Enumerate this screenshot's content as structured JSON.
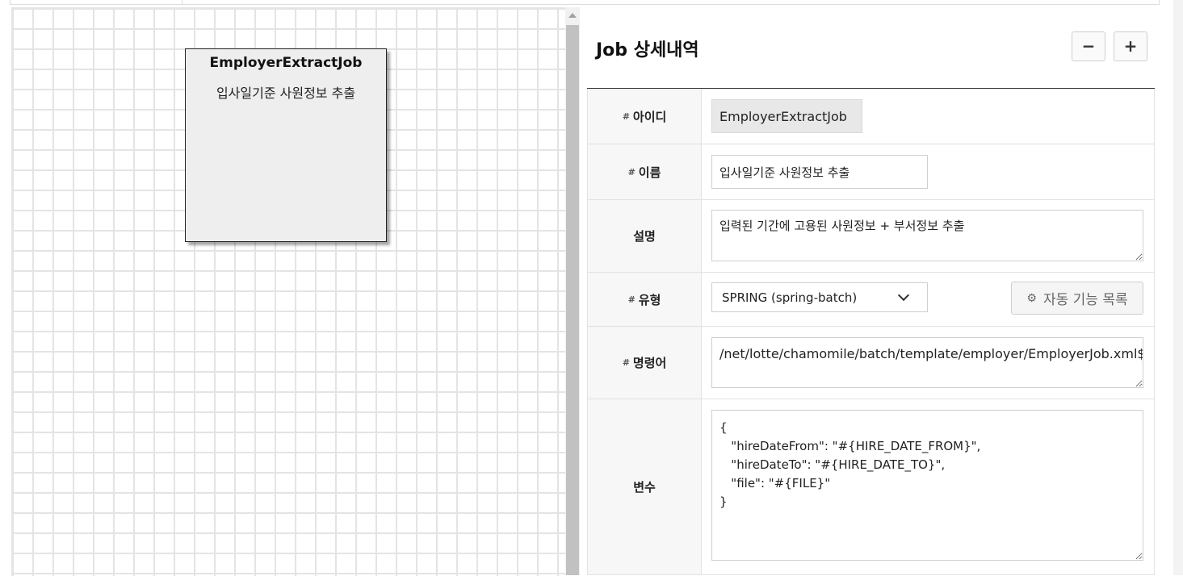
{
  "canvas": {
    "node": {
      "title": "EmployerExtractJob",
      "description": "입사일기준 사원정보 추출"
    }
  },
  "panel": {
    "title": "Job 상세내역",
    "zoom_out_label": "−",
    "zoom_in_label": "+",
    "required_mark": "#",
    "fields": {
      "id": {
        "label": "아이디",
        "value": "EmployerExtractJob"
      },
      "name": {
        "label": "이름",
        "value": "입사일기준 사원정보 추출"
      },
      "description": {
        "label": "설명",
        "value": "입력된 기간에 고용된 사원정보 + 부서정보 추출"
      },
      "type": {
        "label": "유형",
        "value": "SPRING (spring-batch)",
        "button_label": "자동 기능 목록"
      },
      "command": {
        "label": "명령어",
        "value": "/net/lotte/chamomile/batch/template/employer/EmployerJob.xml$employerExtractJob"
      },
      "variables": {
        "label": "변수",
        "value": "{\n   \"hireDateFrom\": \"#{HIRE_DATE_FROM}\",\n   \"hireDateTo\": \"#{HIRE_DATE_TO}\",\n   \"file\": \"#{FILE}\"\n}"
      }
    }
  },
  "icons": {
    "gear": "gear-icon",
    "chevron": "chevron-down-icon"
  }
}
